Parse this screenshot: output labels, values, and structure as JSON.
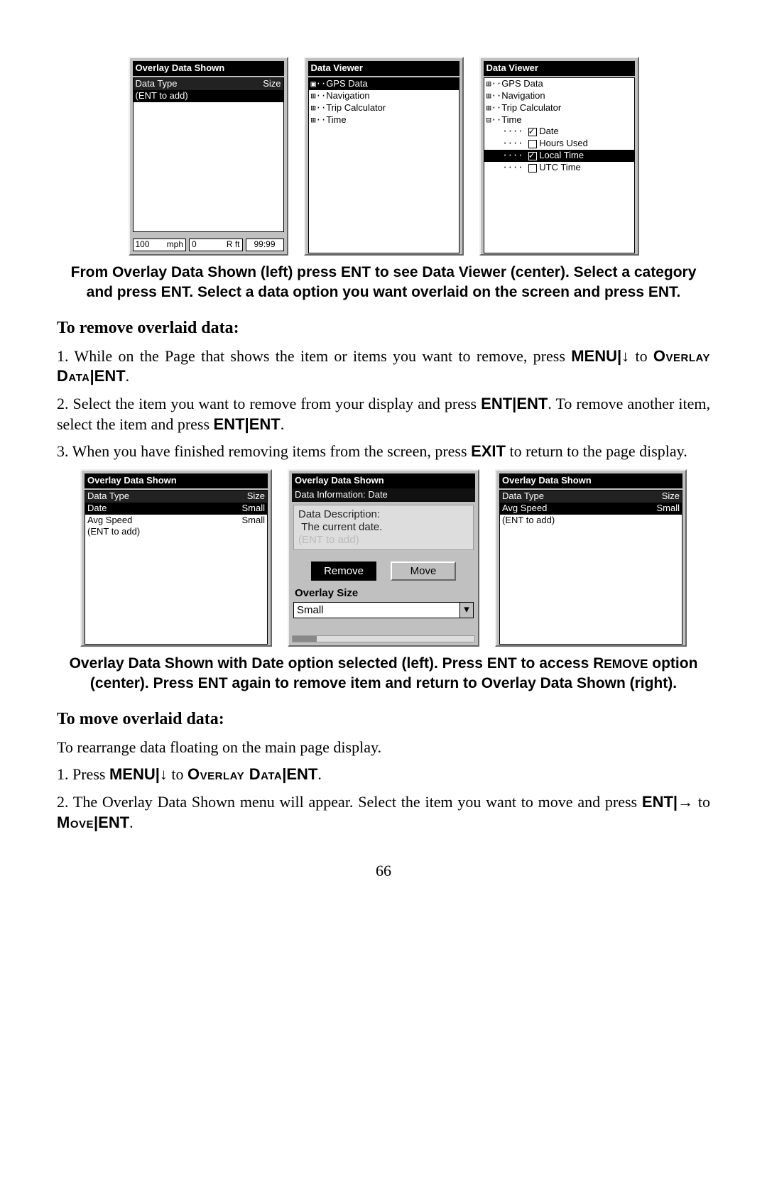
{
  "figures": {
    "top": {
      "panel1": {
        "title": "Overlay Data Shown",
        "header_left": "Data Type",
        "header_right": "Size",
        "rows": [
          {
            "left": "(ENT to add)",
            "right": "",
            "sel": true
          }
        ],
        "status": {
          "a1": "100",
          "a2": "mph",
          "b1": "0",
          "b2": "R  ft",
          "c": "99:99"
        }
      },
      "panel2": {
        "title": "Data Viewer",
        "tree": [
          {
            "glyph": "▣··",
            "label": "GPS Data",
            "sel": true
          },
          {
            "glyph": "⊞··",
            "label": "Navigation"
          },
          {
            "glyph": "⊞··",
            "label": "Trip Calculator"
          },
          {
            "glyph": "⊞··",
            "label": "Time"
          }
        ]
      },
      "panel3": {
        "title": "Data Viewer",
        "tree": [
          {
            "glyph": "⊞··",
            "label": "GPS Data"
          },
          {
            "glyph": "⊞··",
            "label": "Navigation"
          },
          {
            "glyph": "⊞··",
            "label": "Trip Calculator"
          },
          {
            "glyph": "⊟··",
            "label": "Time"
          }
        ],
        "children": [
          {
            "checked": true,
            "label": "Date",
            "sel": false
          },
          {
            "checked": false,
            "label": "Hours Used",
            "sel": false
          },
          {
            "checked": true,
            "label": "Local Time",
            "sel": true
          },
          {
            "checked": false,
            "label": "UTC Time",
            "sel": false
          }
        ]
      }
    },
    "bottom": {
      "panel1": {
        "title": "Overlay Data Shown",
        "header_left": "Data Type",
        "header_right": "Size",
        "rows": [
          {
            "left": "Date",
            "right": "Small",
            "sel": true
          },
          {
            "left": "Avg Speed",
            "right": "Small",
            "sel": false
          },
          {
            "left": "(ENT to add)",
            "right": "",
            "sel": false
          }
        ]
      },
      "panel2": {
        "title": "Overlay Data Shown",
        "subtitle": "Data Information: Date",
        "desc_label": "Data Description:",
        "desc_value": "The current date.",
        "ghost": "(ENT to add)",
        "btn_remove": "Remove",
        "btn_move": "Move",
        "size_label": "Overlay Size",
        "size_value": "Small"
      },
      "panel3": {
        "title": "Overlay Data Shown",
        "header_left": "Data Type",
        "header_right": "Size",
        "rows": [
          {
            "left": "Avg Speed",
            "right": "Small",
            "sel": true
          },
          {
            "left": "(ENT to add)",
            "right": "",
            "sel": false
          }
        ]
      }
    }
  },
  "captions": {
    "top": "From Overlay Data Shown (left) press ENT to see Data Viewer (center). Select a category and press ENT. Select a data option you want overlaid on the screen and press ENT.",
    "bottom_a": "Overlay Data Shown with Date option selected (left). Press ENT to access ",
    "bottom_b": "R",
    "bottom_c": "EMOVE",
    "bottom_d": " option (center). Press ENT again to remove item and return to Overlay Data Shown (right)."
  },
  "body": {
    "remove_heading": "To remove overlaid data:",
    "remove_1a": "1. While on the Page that shows the item or items you want to remove, press ",
    "menu": "MENU",
    "bar": "|",
    "down": "↓",
    "to": " to ",
    "overlay": "Overlay Data",
    "ent": "ENT",
    "period": ".",
    "remove_2a": "2. Select the item you want to remove from your display and press ",
    "remove_2b": ". To remove another item, select the item and press ",
    "remove_3a": "3. When you have finished removing items from the screen, press ",
    "exit": "EXIT",
    "remove_3b": " to return to the page display.",
    "move_heading": "To move overlaid data:",
    "move_intro": "To rearrange data floating on the main page display.",
    "move_1": "1. Press ",
    "move_2a": "2. The Overlay Data Shown menu will appear. Select the item you want to move and press ",
    "right": "→",
    "move_word": "Move"
  },
  "page_number": "66"
}
